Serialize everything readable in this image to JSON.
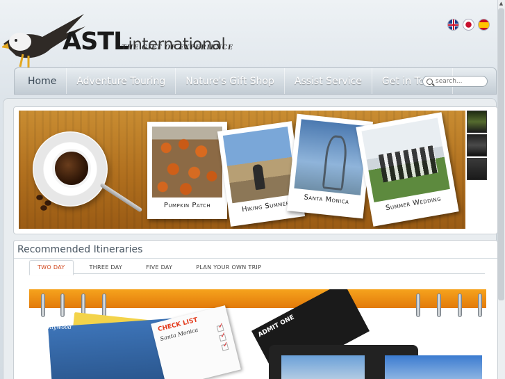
{
  "brand": {
    "name_bold": "ASTL",
    "name_rest": "international",
    "tagline": "THE GIFT OF EXPERIENCE"
  },
  "languages": [
    {
      "name": "English",
      "icon": "uk-flag-icon"
    },
    {
      "name": "Japanese",
      "icon": "japan-flag-icon"
    },
    {
      "name": "Spanish",
      "icon": "spain-flag-icon"
    }
  ],
  "nav": {
    "items": [
      {
        "label": "Home",
        "active": true
      },
      {
        "label": "Adventure Touring"
      },
      {
        "label": "Nature's Gift Shop"
      },
      {
        "label": "Assist Service"
      },
      {
        "label": "Get in Touch"
      }
    ],
    "search_placeholder": "search..."
  },
  "slider": {
    "photos": [
      {
        "caption": "Pumpkin Patch"
      },
      {
        "caption": "Hiking Summer"
      },
      {
        "caption": "Santa Monica"
      },
      {
        "caption": "Summer Wedding"
      }
    ]
  },
  "itineraries": {
    "title": "Recommended Itineraries",
    "tabs": [
      {
        "label": "TWO DAY",
        "active": true
      },
      {
        "label": "THREE DAY"
      },
      {
        "label": "FIVE DAY"
      },
      {
        "label": "PLAN YOUR OWN TRIP"
      }
    ],
    "image_text": {
      "hollywood": "Hollywood",
      "checklist_title": "CHECK LIST",
      "checklist_sub": "Santa Monica",
      "ticket": "ADMIT ONE"
    }
  },
  "colors": {
    "active_tab": "#d0451b",
    "nav_text": "#ffffff",
    "planner_band": "#f6a31d"
  }
}
